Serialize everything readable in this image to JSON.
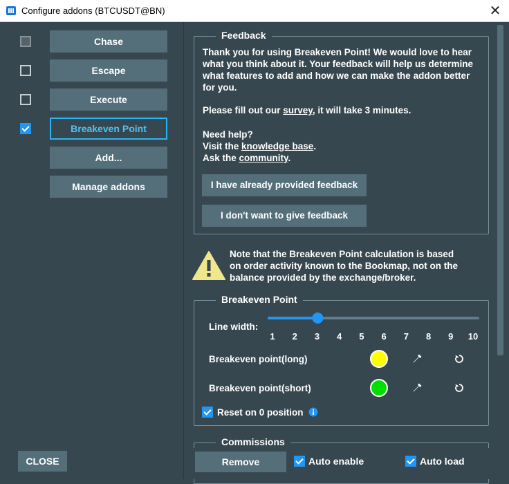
{
  "window": {
    "title": "Configure addons (BTCUSDT@BN)"
  },
  "addons": [
    {
      "label": "Chase",
      "checked": false
    },
    {
      "label": "Escape",
      "checked": false
    },
    {
      "label": "Execute",
      "checked": false
    },
    {
      "label": "Breakeven Point",
      "checked": true
    }
  ],
  "left_buttons": {
    "add": "Add...",
    "manage": "Manage addons",
    "close": "CLOSE"
  },
  "feedback": {
    "legend": "Feedback",
    "para1": "Thank you for using Breakeven Point! We would love to hear what you think about it. Your feedback will help us determine what features to add and how we can make the addon better for you.",
    "survey_pre": "Please fill out our ",
    "survey_link": "survey",
    "survey_post": ", it will take 3 minutes.",
    "help_title": "Need help?",
    "visit_pre": "Visit the ",
    "kb_link": "knowledge base",
    "visit_post": ".",
    "ask_pre": "Ask the ",
    "community_link": "community",
    "ask_post": ".",
    "btn_provided": "I have already provided feedback",
    "btn_no": "I don't want to give feedback"
  },
  "warning": {
    "icon": "warning-icon",
    "text": "Note that the Breakeven Point calculation is based on order activity known to the Bookmap, not on the balance provided by the exchange/broker."
  },
  "breakeven": {
    "legend": "Breakeven Point",
    "line_width_label": "Line width:",
    "ticks": [
      "1",
      "2",
      "3",
      "4",
      "5",
      "6",
      "7",
      "8",
      "9",
      "10"
    ],
    "line_width_value": 3,
    "long_label": "Breakeven point(long)",
    "short_label": "Breakeven point(short)",
    "long_color": "#ffff00",
    "short_color": "#00e000",
    "reset_label": "Reset on 0 position",
    "reset_checked": true
  },
  "commissions": {
    "legend": "Commissions"
  },
  "bottom": {
    "remove": "Remove",
    "auto_enable": "Auto enable",
    "auto_enable_checked": true,
    "auto_load": "Auto load",
    "auto_load_checked": true
  },
  "colors": {
    "accent": "#2196f3",
    "panel": "#37474f",
    "button": "#546e7a"
  }
}
